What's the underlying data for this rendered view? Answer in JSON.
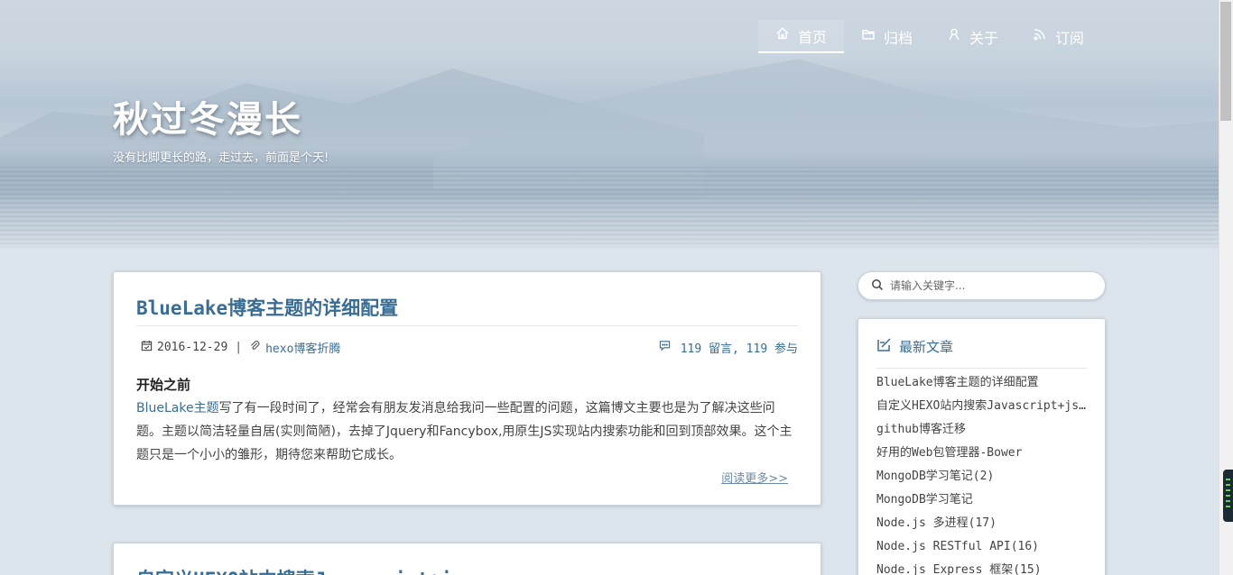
{
  "site": {
    "title": "秋过冬漫长",
    "description": "没有比脚更长的路，走过去，前面是个天!"
  },
  "nav": {
    "items": [
      {
        "label": "首页",
        "icon": "home-icon",
        "active": true
      },
      {
        "label": "归档",
        "icon": "folder-icon",
        "active": false
      },
      {
        "label": "关于",
        "icon": "user-icon",
        "active": false
      },
      {
        "label": "订阅",
        "icon": "rss-icon",
        "active": false
      }
    ]
  },
  "posts": [
    {
      "title": "BlueLake博客主题的详细配置",
      "date": "2016-12-29",
      "category": "hexo博客折腾",
      "comments": "119 留言, 119 参与",
      "section_heading": "开始之前",
      "excerpt_link": "BlueLake主题",
      "excerpt": "写了有一段时间了，经常会有朋友发消息给我问一些配置的问题，这篇博文主要也是为了解决这些问题。主题以简洁轻量自居(实则简陋)，去掉了Jquery和Fancybox,用原生JS实现站内搜索功能和回到顶部效果。这个主题只是一个小小的雏形，期待您来帮助它成长。",
      "read_more": "阅读更多>>"
    },
    {
      "title": "自定义HEXO站内搜索Javascript+json"
    }
  ],
  "search": {
    "placeholder": "请输入关键字..."
  },
  "recent": {
    "heading": "最新文章",
    "items": [
      "BlueLake博客主题的详细配置",
      "自定义HEXO站内搜索Javascript+json",
      "github博客迁移",
      "好用的Web包管理器-Bower",
      "MongoDB学习笔记(2)",
      "MongoDB学习笔记",
      "Node.js 多进程(17)",
      "Node.js RESTful API(16)",
      "Node.js Express 框架(15)"
    ]
  },
  "colors": {
    "accent": "#3a6d93",
    "background": "#dde5ec"
  }
}
